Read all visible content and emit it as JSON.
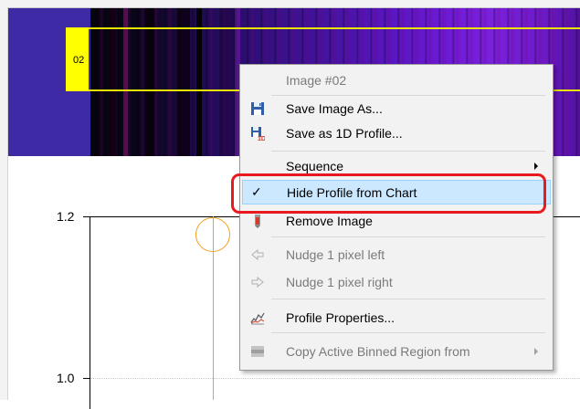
{
  "strip": {
    "profile_label": "02",
    "colors": {
      "selection_border": "#e8e200",
      "selection_label_bg": "#ffff00",
      "spectrum_bg": "#3f2aa5"
    }
  },
  "chart": {
    "y_ticks": [
      "1.2",
      "1.0"
    ],
    "marker_color": "#f0a020"
  },
  "context_menu": {
    "items": [
      {
        "label": "Image #02",
        "enabled": false,
        "icon": ""
      },
      {
        "label": "Save Image As...",
        "enabled": true,
        "icon": "floppy-disk-icon"
      },
      {
        "label": "Save as 1D Profile...",
        "enabled": true,
        "icon": "floppy-disk-1d-icon"
      },
      {
        "label": "Sequence",
        "enabled": true,
        "icon": "",
        "submenu": true
      },
      {
        "label": "Hide Profile from Chart",
        "enabled": true,
        "icon": "checkmark-icon",
        "checked": true,
        "highlighted": true
      },
      {
        "label": "Remove Image",
        "enabled": true,
        "icon": "remove-image-icon"
      },
      {
        "label": "Nudge 1 pixel left",
        "enabled": false,
        "icon": "arrow-left-icon"
      },
      {
        "label": "Nudge 1 pixel right",
        "enabled": false,
        "icon": "arrow-right-icon"
      },
      {
        "label": "Profile Properties...",
        "enabled": true,
        "icon": "profile-properties-icon"
      },
      {
        "label": "Copy Active Binned Region from",
        "enabled": false,
        "icon": "binned-region-icon",
        "submenu": true
      }
    ],
    "highlight_colors": {
      "fill": "#cce8ff",
      "border": "#99d1ff",
      "annotation": "#e8191f"
    }
  }
}
